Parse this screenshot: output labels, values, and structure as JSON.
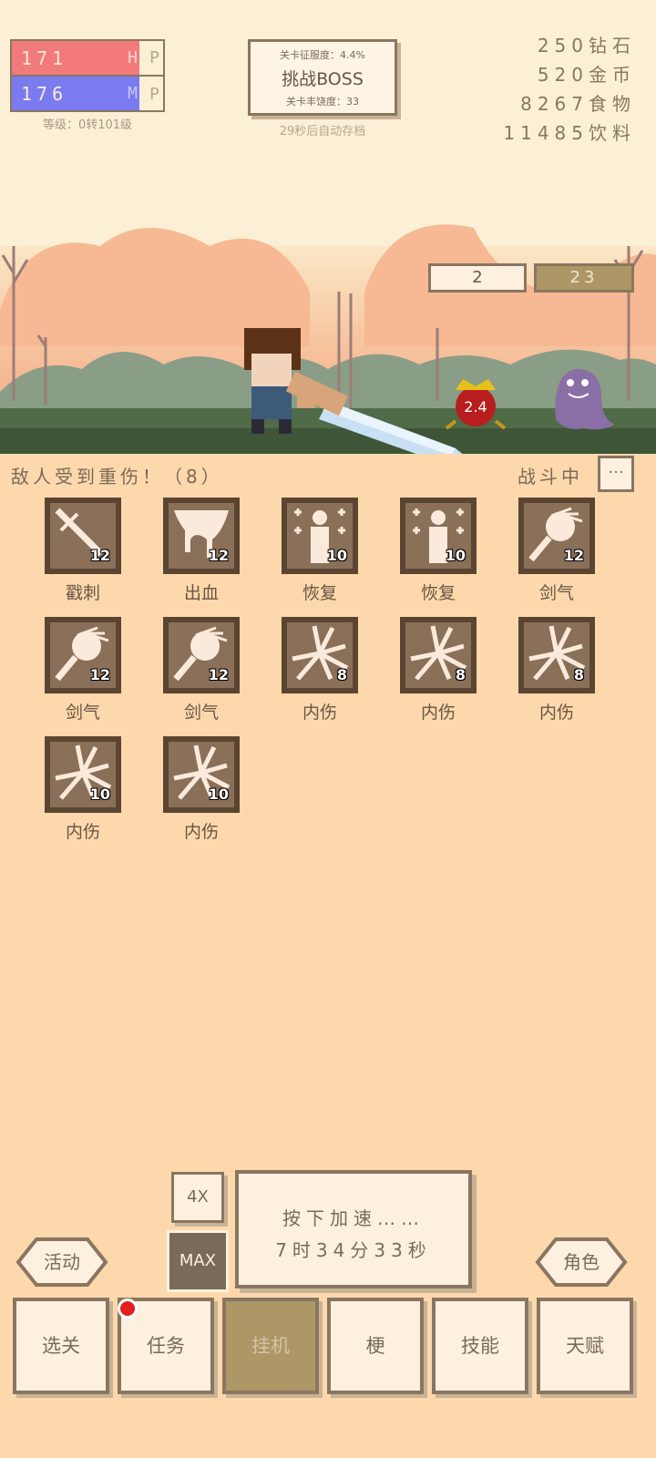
{
  "stats": {
    "hp_value": "171",
    "hp_letter": "H",
    "mp_value": "176",
    "mp_letter": "M",
    "p_letter": "P",
    "level_text": "等级：0转101级"
  },
  "boss": {
    "conquest_text": "关卡征服度：4.4%",
    "button_label": "挑战BOSS",
    "richness_text": "关卡丰饶度：33",
    "autosave_text": "29秒后自动存档"
  },
  "resources": [
    {
      "value": "250",
      "unit": "钻石"
    },
    {
      "value": "520",
      "unit": "金币"
    },
    {
      "value": "8267",
      "unit": "食物"
    },
    {
      "value": "11485",
      "unit": "饮料"
    }
  ],
  "scene": {
    "wave_current": "2",
    "wave_total": "23",
    "enemy_hp": "2.4"
  },
  "battle": {
    "message": "敌人受到重伤！（8）",
    "status": "战斗中",
    "more_label": "···"
  },
  "skills": [
    {
      "name": "戳刺",
      "count": "12",
      "icon": "stab-icon"
    },
    {
      "name": "出血",
      "count": "12",
      "icon": "bleed-icon"
    },
    {
      "name": "恢复",
      "count": "10",
      "icon": "recover-icon"
    },
    {
      "name": "恢复",
      "count": "10",
      "icon": "recover-icon"
    },
    {
      "name": "剑气",
      "count": "12",
      "icon": "sword-aura-icon"
    },
    {
      "name": "剑气",
      "count": "12",
      "icon": "sword-aura-icon"
    },
    {
      "name": "剑气",
      "count": "12",
      "icon": "sword-aura-icon"
    },
    {
      "name": "内伤",
      "count": "8",
      "icon": "internal-injury-icon"
    },
    {
      "name": "内伤",
      "count": "8",
      "icon": "internal-injury-icon"
    },
    {
      "name": "内伤",
      "count": "8",
      "icon": "internal-injury-icon"
    },
    {
      "name": "内伤",
      "count": "10",
      "icon": "internal-injury-icon"
    },
    {
      "name": "内伤",
      "count": "10",
      "icon": "internal-injury-icon"
    }
  ],
  "controls": {
    "speed_label": "4X",
    "max_label": "MAX",
    "accel_line1": "按下加速……",
    "accel_line2": "7时34分33秒",
    "activity_label": "活动",
    "character_label": "角色"
  },
  "tabs": [
    {
      "label": "选关"
    },
    {
      "label": "任务"
    },
    {
      "label": "挂机"
    },
    {
      "label": "梗"
    },
    {
      "label": "技能"
    },
    {
      "label": "天赋"
    }
  ],
  "colors": {
    "background": "#fdd8ac",
    "hp_bar": "#f27a7a",
    "mp_bar": "#7b7bf0",
    "border": "#8a7660",
    "active_tab": "#ad9767",
    "notification_dot": "#e51e1e"
  }
}
